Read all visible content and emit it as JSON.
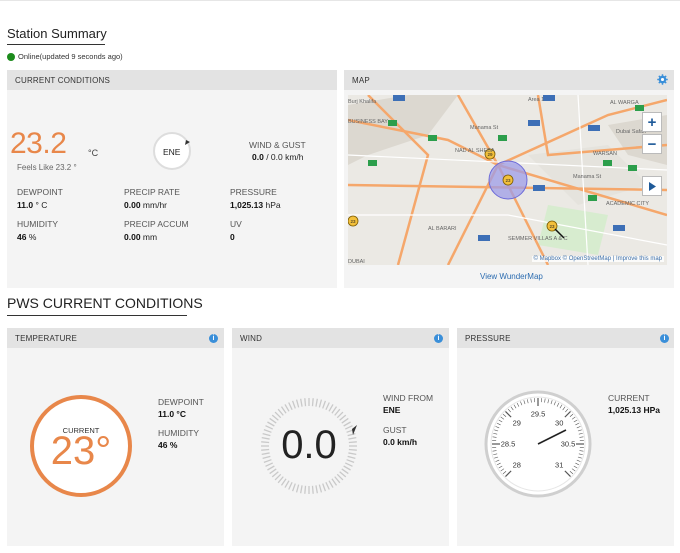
{
  "station": {
    "title": "Station Summary",
    "status": "Online(updated 9 seconds ago)"
  },
  "current_conditions": {
    "title": "CURRENT CONDITIONS",
    "temperature": "23.2",
    "temperature_unit": "°C",
    "feels_like": "Feels Like 23.2 °",
    "wind_direction": "ENE",
    "wind_gust_label": "WIND & GUST",
    "wind_gust_value": "0.0",
    "wind_gust_rest": "/ 0.0 km/h",
    "dewpoint_label": "DEWPOINT",
    "dewpoint_value": "11.0",
    "dewpoint_unit": "° C",
    "precip_rate_label": "PRECIP RATE",
    "precip_rate_value": "0.00",
    "precip_rate_unit": "mm/hr",
    "pressure_label": "PRESSURE",
    "pressure_value": "1,025.13",
    "pressure_unit": "hPa",
    "humidity_label": "HUMIDITY",
    "humidity_value": "46",
    "humidity_unit": "%",
    "precip_accum_label": "PRECIP ACCUM",
    "precip_accum_value": "0.00",
    "precip_accum_unit": "mm",
    "uv_label": "UV",
    "uv_value": "0"
  },
  "map": {
    "title": "MAP",
    "credit": "© Mapbox © OpenStreetMap | Improve this map",
    "zoom_in": "+",
    "zoom_out": "−",
    "view_link": "View WunderMap",
    "labels": [
      "Area 1",
      "AL WARGA",
      "Dubai Safari",
      "WARSAN",
      "ACADEMIC CITY",
      "AL BARARI",
      "DUBAI",
      "Manama St",
      "NAD AL SHEBA",
      "SEMMER VILLAS A & C",
      "Burj Khalifa",
      "BUSINESS BAY",
      "Manama St"
    ],
    "marker_labels": [
      "29",
      "23",
      "23",
      "23"
    ],
    "icons": [
      "zoom-in-icon",
      "zoom-out-icon",
      "play-icon",
      "gear-icon"
    ]
  },
  "pws": {
    "title": "PWS CURRENT CONDITIONS",
    "temperature": {
      "title": "TEMPERATURE",
      "current_label": "CURRENT",
      "current_value": "23°",
      "dewpoint_label": "DEWPOINT",
      "dewpoint_value": "11.0 °C",
      "humidity_label": "HUMIDITY",
      "humidity_value": "46 %"
    },
    "wind": {
      "title": "WIND",
      "speed": "0.0",
      "from_label": "WIND FROM",
      "from_value": "ENE",
      "gust_label": "GUST",
      "gust_value": "0.0 km/h"
    },
    "pressure": {
      "title": "PRESSURE",
      "current_label": "CURRENT",
      "current_value": "1,025.13 HPa",
      "scale": [
        "28",
        "28.5",
        "29",
        "29.5",
        "30",
        "30.5",
        "31"
      ]
    },
    "info_icon": "i"
  },
  "colors": {
    "temp_orange": "#e8874a",
    "info_blue": "#3a8fd9",
    "online_green": "#1c8b1c"
  }
}
